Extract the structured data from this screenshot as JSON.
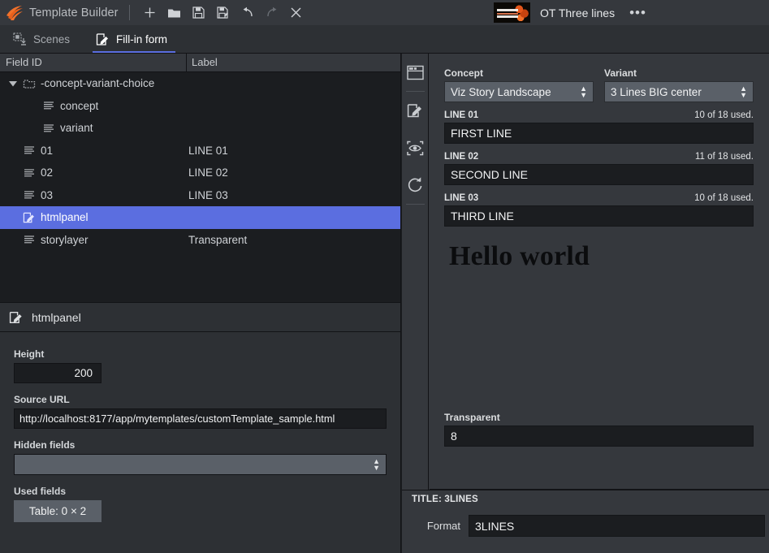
{
  "titlebar": {
    "app_name": "Template Builder",
    "logo_icon": "viz-flame-logo-icon",
    "buttons": [
      {
        "name": "new",
        "icon": "plus-icon",
        "disabled": false
      },
      {
        "name": "open",
        "icon": "folder-icon",
        "disabled": false
      },
      {
        "name": "save",
        "icon": "save-icon",
        "disabled": false
      },
      {
        "name": "save-as",
        "icon": "save-as-icon",
        "disabled": false
      },
      {
        "name": "undo",
        "icon": "undo-icon",
        "disabled": false
      },
      {
        "name": "redo",
        "icon": "redo-icon",
        "disabled": true
      },
      {
        "name": "close",
        "icon": "close-icon",
        "disabled": false
      }
    ],
    "document": {
      "name": "OT Three lines",
      "thumbnail_icon": "template-thumbnail",
      "overflow_menu": "•••"
    }
  },
  "tabs": [
    {
      "label": "Scenes",
      "icon": "scenes-icon",
      "active": false
    },
    {
      "label": "Fill-in form",
      "icon": "fill-in-form-icon",
      "active": true
    }
  ],
  "accent_color": "#5b6ee0",
  "tree": {
    "columns": [
      "Field ID",
      "Label"
    ],
    "rows": [
      {
        "id": "-concept-variant-choice",
        "label": "",
        "icon": "group-folder-icon",
        "depth": 0,
        "twisty": "▼",
        "selected": false
      },
      {
        "id": "concept",
        "label": "",
        "icon": "text-field-icon",
        "depth": 1,
        "twisty": "",
        "selected": false
      },
      {
        "id": "variant",
        "label": "",
        "icon": "text-field-icon",
        "depth": 1,
        "twisty": "",
        "selected": false
      },
      {
        "id": "01",
        "label": "LINE 01",
        "icon": "text-field-icon",
        "depth": 0,
        "twisty": "",
        "selected": false
      },
      {
        "id": "02",
        "label": "LINE 02",
        "icon": "text-field-icon",
        "depth": 0,
        "twisty": "",
        "selected": false
      },
      {
        "id": "03",
        "label": "LINE 03",
        "icon": "text-field-icon",
        "depth": 0,
        "twisty": "",
        "selected": false
      },
      {
        "id": "htmlpanel",
        "label": "",
        "icon": "html-panel-icon",
        "depth": 0,
        "twisty": "",
        "selected": true
      },
      {
        "id": "storylayer",
        "label": "Transparent",
        "icon": "text-field-icon",
        "depth": 0,
        "twisty": "",
        "selected": false
      }
    ]
  },
  "properties": {
    "header_title": "htmlpanel",
    "header_icon": "html-panel-icon",
    "height_label": "Height",
    "height_value": "200",
    "source_url_label": "Source URL",
    "source_url_value": "http://localhost:8177/app/mytemplates/customTemplate_sample.html",
    "hidden_fields_label": "Hidden fields",
    "hidden_fields_value": "",
    "used_fields_label": "Used fields",
    "used_fields_button": "Table: 0 × 2"
  },
  "rail": [
    {
      "name": "panel",
      "icon": "window-panel-icon"
    },
    {
      "name": "edit",
      "icon": "edit-pencil-icon"
    },
    {
      "name": "preview",
      "icon": "eye-preview-icon"
    },
    {
      "name": "refresh",
      "icon": "refresh-icon"
    }
  ],
  "form": {
    "concept": {
      "label": "Concept",
      "value": "Viz Story Landscape"
    },
    "variant": {
      "label": "Variant",
      "value": "3 Lines BIG center"
    },
    "lines": [
      {
        "label": "LINE 01",
        "used": "10 of 18 used.",
        "value": "FIRST LINE"
      },
      {
        "label": "LINE 02",
        "used": "11 of 18 used.",
        "value": "SECOND LINE"
      },
      {
        "label": "LINE 03",
        "used": "10 of 18 used.",
        "value": "THIRD LINE"
      }
    ],
    "html_preview_text": "Hello world",
    "transparent": {
      "label": "Transparent",
      "value": "8"
    }
  },
  "bottom": {
    "title": "TITLE: 3LINES",
    "format_label": "Format",
    "format_value": "3LINES"
  }
}
